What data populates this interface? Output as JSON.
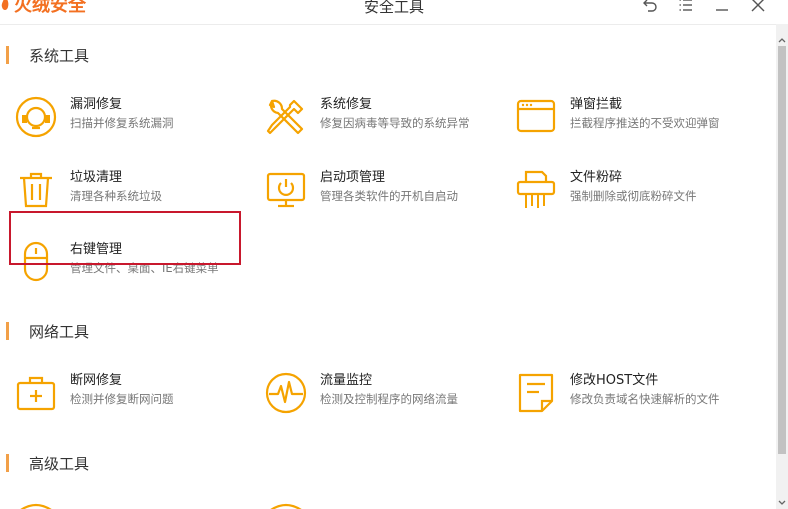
{
  "window": {
    "app_name": "火绒安全",
    "title": "安全工具",
    "controls": [
      "back-arrow-icon",
      "menu-icon",
      "minimize-icon",
      "close-icon"
    ]
  },
  "sections": [
    {
      "label": "系统工具",
      "tools": [
        {
          "name": "漏洞修复",
          "desc": "扫描并修复系统漏洞",
          "icon": "vulnerability-fix-icon"
        },
        {
          "name": "系统修复",
          "desc": "修复因病毒等导致的系统异常",
          "icon": "wrench-screwdriver-icon"
        },
        {
          "name": "弹窗拦截",
          "desc": "拦截程序推送的不受欢迎弹窗",
          "icon": "popup-window-icon"
        },
        {
          "name": "垃圾清理",
          "desc": "清理各种系统垃圾",
          "icon": "trash-bin-icon"
        },
        {
          "name": "启动项管理",
          "desc": "管理各类软件的开机自启动",
          "icon": "monitor-power-icon"
        },
        {
          "name": "文件粉碎",
          "desc": "强制删除或彻底粉碎文件",
          "icon": "shredder-icon"
        },
        {
          "name": "右键管理",
          "desc": "管理文件、桌面、IE右键菜单",
          "icon": "mouse-icon"
        }
      ]
    },
    {
      "label": "网络工具",
      "tools": [
        {
          "name": "断网修复",
          "desc": "检测并修复断网问题",
          "icon": "first-aid-kit-icon"
        },
        {
          "name": "流量监控",
          "desc": "检测及控制程序的网络流量",
          "icon": "pulse-monitor-icon"
        },
        {
          "name": "修改HOST文件",
          "desc": "修改负责域名快速解析的文件",
          "icon": "document-icon"
        }
      ]
    },
    {
      "label": "高级工具",
      "tools": []
    }
  ],
  "colors": {
    "accent": "#f5a300",
    "section_bar": "#f2a048",
    "highlight_border": "#c8182d",
    "brand": "#f37021"
  }
}
